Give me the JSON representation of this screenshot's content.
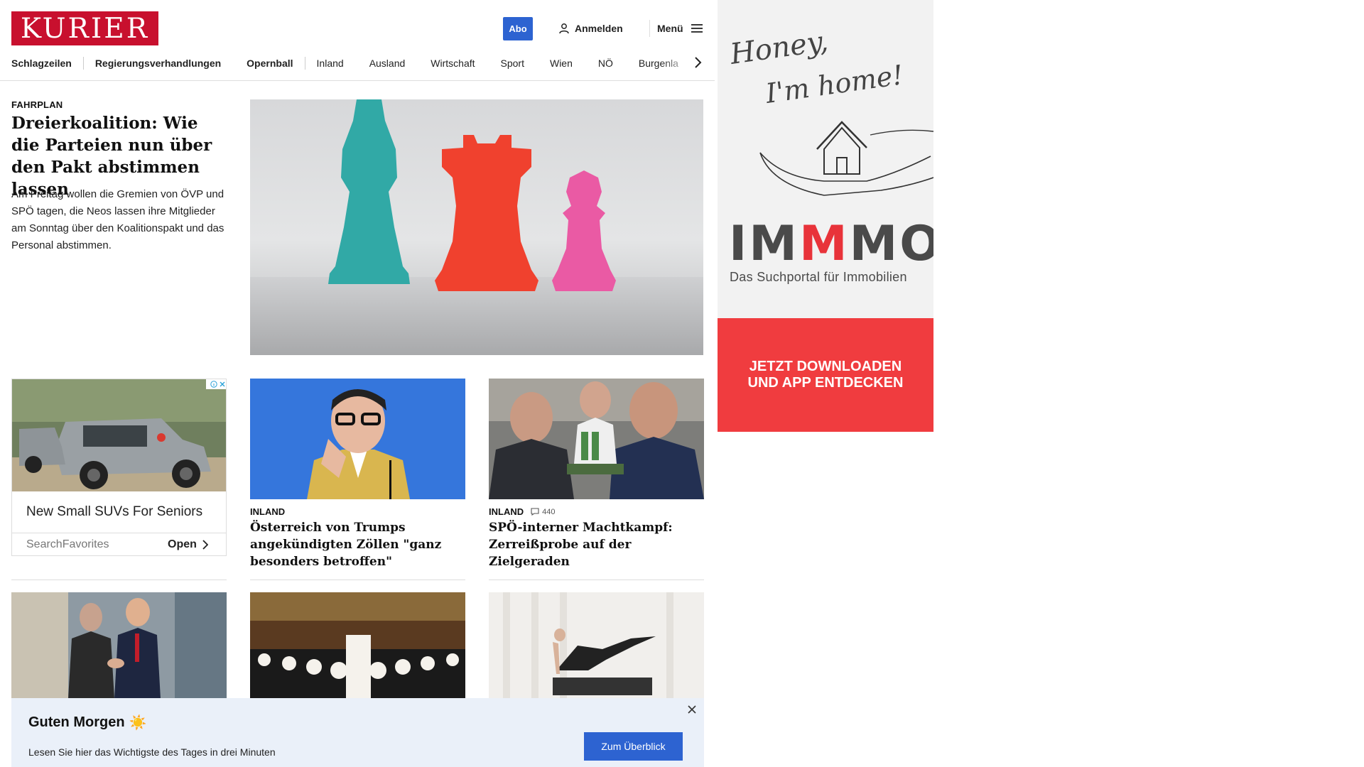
{
  "header": {
    "logo": "KURIER",
    "abo_label": "Abo",
    "login_label": "Anmelden",
    "menu_label": "Menü"
  },
  "nav": {
    "items": [
      "Schlagzeilen",
      "Regierungsverhandlungen",
      "Opernball",
      "Inland",
      "Ausland",
      "Wirtschaft",
      "Sport",
      "Wien",
      "NÖ",
      "Burgenla"
    ]
  },
  "lead": {
    "kicker": "FAHRPLAN",
    "title": "Dreierkoalition: Wie die Parteien nun über den Pakt abstimmen lassen",
    "teaser": "Am Freitag wollen die Gremien von ÖVP und SPÖ tagen, die Neos lassen ihre Mitglieder am Sonntag über den Koalitionspakt und das Personal abstimmen."
  },
  "ad_card": {
    "title": "New Small SUVs For Seniors",
    "source": "SearchFavorites",
    "open_label": "Open"
  },
  "cards": [
    {
      "kicker": "INLAND",
      "title": "Österreich von Trumps angekündigten Zöllen \"ganz besonders betroffen\""
    },
    {
      "kicker": "INLAND",
      "comments": "440",
      "title": "SPÖ-interner Machtkampf: Zerreißprobe auf der Zielgeraden"
    }
  ],
  "briefing": {
    "title": "Guten Morgen",
    "emoji": "☀️",
    "text": "Lesen Sie hier das Wichtigste des Tages in drei Minuten",
    "cta_label": "Zum Überblick"
  },
  "side_ad": {
    "script_text_1": "Honey,",
    "script_text_2": "I'm home!",
    "brand_part1": "IM",
    "brand_part2": "M",
    "brand_part3": "MO",
    "tagline": "Das Suchportal für Immobilien",
    "cta_line1": "JETZT DOWNLOADEN",
    "cta_line2": "UND APP ENTDECKEN"
  },
  "colors": {
    "brand_red": "#c8102e",
    "accent_blue": "#2d63d1",
    "ad_red": "#f03c3f",
    "briefing_bg": "#eaf0f9"
  }
}
